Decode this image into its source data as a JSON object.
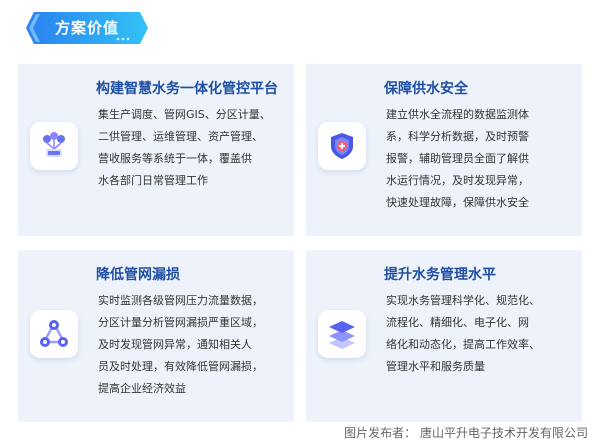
{
  "header": {
    "title": "方案价值"
  },
  "cards": [
    {
      "title": "构建智慧水务一体化管控平台",
      "lines": [
        "集生产调度、管网GIS、分区计量、",
        "二供管理、运维管理、资产管理、",
        "营收服务等系统于一体，覆盖供",
        "水各部门日常管理工作"
      ],
      "icon": "server-cluster-icon"
    },
    {
      "title": "保障供水安全",
      "lines": [
        "建立供水全流程的数据监测体",
        "系，科学分析数据，及时预警",
        "报警，辅助管理员全面了解供",
        "水运行情况，及时发现异常，",
        "快速处理故障，保障供水安全"
      ],
      "icon": "shield-icon"
    },
    {
      "title": "降低管网漏损",
      "lines": [
        "实时监测各级管网压力流量数据，",
        "分区计量分析管网漏损严重区域，",
        "及时发现管网异常，通知相关人",
        "员及时处理，有效降低管网漏损，",
        "提高企业经济效益"
      ],
      "icon": "network-nodes-icon"
    },
    {
      "title": "提升水务管理水平",
      "lines": [
        "实现水务管理科学化、规范化、",
        "流程化、精细化、电子化、网",
        "络化和动态化，提高工作效率、",
        "管理水平和服务质量"
      ],
      "icon": "layers-icon"
    }
  ],
  "footer": {
    "credit": "图片发布者：  唐山平升电子技术开发有限公司"
  },
  "colors": {
    "accent": "#1f4fa3",
    "card_bg": "#eef3fb",
    "badge_start": "#2a8df2",
    "badge_end": "#34c6f4"
  }
}
